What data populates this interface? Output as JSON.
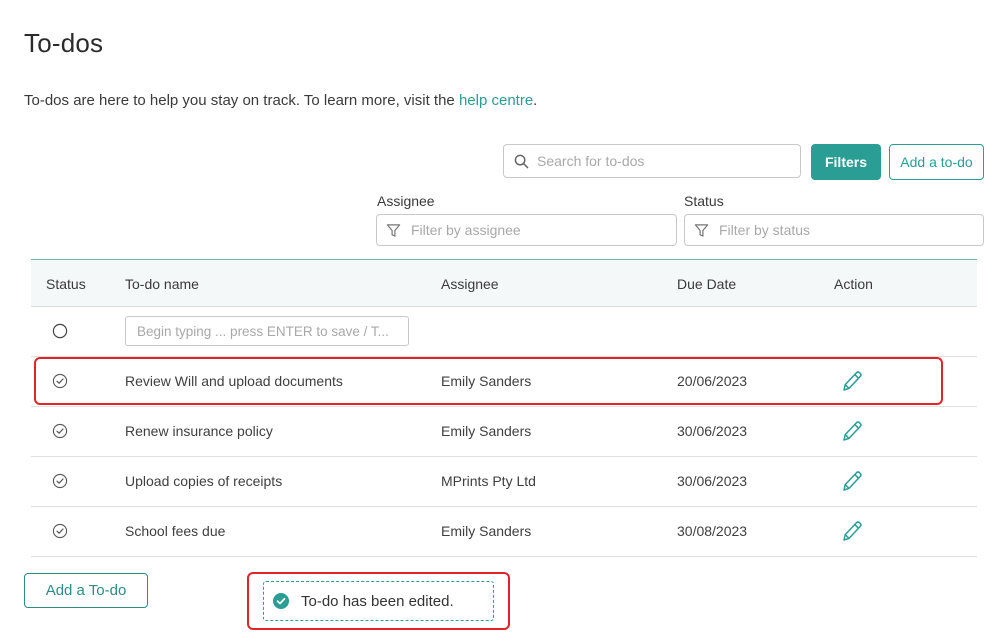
{
  "page": {
    "title": "To-dos",
    "intro_text": "To-dos are here to help you stay on track. To learn more, visit the ",
    "intro_link": "help centre",
    "intro_end": "."
  },
  "toolbar": {
    "search_placeholder": "Search for to-dos",
    "filters_label": "Filters",
    "add_label": "Add a to-do"
  },
  "filters": {
    "assignee_label": "Assignee",
    "assignee_placeholder": "Filter by assignee",
    "status_label": "Status",
    "status_placeholder": "Filter by status"
  },
  "table": {
    "headers": [
      "Status",
      "To-do name",
      "Assignee",
      "Due Date",
      "Action"
    ],
    "new_placeholder": "Begin typing ... press ENTER to save / T...",
    "rows": [
      {
        "name": "Review Will and upload documents",
        "assignee": "Emily Sanders",
        "due": "20/06/2023"
      },
      {
        "name": "Renew insurance policy",
        "assignee": "Emily Sanders",
        "due": "30/06/2023"
      },
      {
        "name": "Upload copies of receipts",
        "assignee": "MPrints Pty Ltd",
        "due": "30/06/2023"
      },
      {
        "name": "School fees due",
        "assignee": "Emily Sanders",
        "due": "30/08/2023"
      }
    ]
  },
  "bottom": {
    "add_label": "Add a To-do",
    "toast_text": "To-do has been edited."
  },
  "colors": {
    "accent": "#2a9d94",
    "highlight": "#e0242a"
  }
}
